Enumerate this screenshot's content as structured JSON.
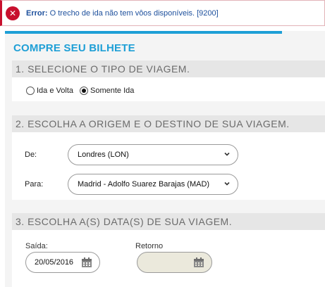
{
  "error": {
    "icon": "close-icon",
    "label": "Error:",
    "message": " O trecho de ida não tem vôos disponíveis. [9200]",
    "color": "#c8102e"
  },
  "page": {
    "title": "COMPRE SEU BILHETE",
    "accent": "#1e9fd6"
  },
  "section1": {
    "heading": "1. SELECIONE O TIPO DE VIAGEM.",
    "options": [
      {
        "label": "Ida e Volta",
        "selected": false
      },
      {
        "label": "Somente Ida",
        "selected": true
      }
    ]
  },
  "section2": {
    "heading": "2. ESCOLHA A ORIGEM E O DESTINO DE SUA VIAGEM.",
    "origin_label": "De:",
    "origin_value": "Londres (LON)",
    "destination_label": "Para:",
    "destination_value": "Madrid - Adolfo Suarez Barajas (MAD)"
  },
  "section3": {
    "heading": "3. ESCOLHA A(S) DATA(S) DE SUA VIAGEM.",
    "departure_label": "Saída:",
    "departure_value": "20/05/2016",
    "return_label": "Retorno",
    "return_value": ""
  }
}
